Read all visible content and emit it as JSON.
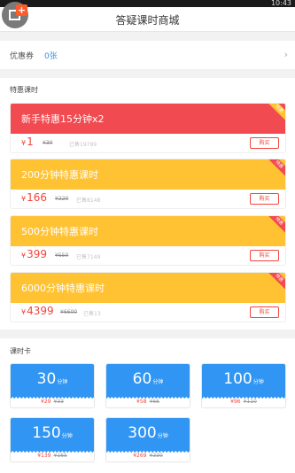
{
  "status_bar": {
    "time": "10:43"
  },
  "nav": {
    "title": "答疑课时商城"
  },
  "coupon": {
    "label": "优惠券",
    "value": "0张"
  },
  "special": {
    "section_title": "特惠课时",
    "offers": [
      {
        "title": "新手特惠15分钟x2",
        "price": "1",
        "original": "¥30",
        "sold": "已售19799",
        "buy": "购买",
        "tag": "特惠"
      },
      {
        "title": "200分钟特惠课时",
        "price": "166",
        "original": "¥220",
        "sold": "已售8148",
        "buy": "购买",
        "tag": "特惠"
      },
      {
        "title": "500分钟特惠课时",
        "price": "399",
        "original": "¥550",
        "sold": "已售7149",
        "buy": "购买",
        "tag": "特惠"
      },
      {
        "title": "6000分钟特惠课时",
        "price": "4399",
        "original": "¥6600",
        "sold": "已售13",
        "buy": "购买",
        "tag": "特惠"
      }
    ],
    "currency": "¥"
  },
  "cards": {
    "section_title": "课时卡",
    "unit": "分钟",
    "items": [
      {
        "minutes": "30",
        "price": "¥29",
        "original": "¥33"
      },
      {
        "minutes": "60",
        "price": "¥58",
        "original": "¥66"
      },
      {
        "minutes": "100",
        "price": "¥96",
        "original": "¥110"
      },
      {
        "minutes": "150",
        "price": "¥139",
        "original": "¥165"
      },
      {
        "minutes": "300",
        "price": "¥269",
        "original": "¥330"
      }
    ]
  },
  "colors": {
    "red": "#f14a50",
    "yellow": "#ffc233",
    "blue": "#3196f3",
    "price": "#f0463c"
  }
}
